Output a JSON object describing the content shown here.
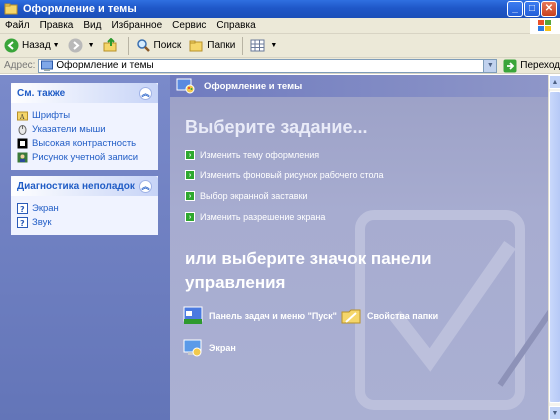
{
  "window": {
    "title": "Оформление и темы",
    "buttons": {
      "minimize": "_",
      "maximize": "□",
      "close": "✕"
    }
  },
  "menu": [
    "Файл",
    "Правка",
    "Вид",
    "Избранное",
    "Сервис",
    "Справка"
  ],
  "toolbar": {
    "back_label": "Назад",
    "search_label": "Поиск",
    "folders_label": "Папки"
  },
  "address": {
    "label": "Адрес:",
    "value": "Оформление и темы",
    "go_label": "Переход"
  },
  "see_also": {
    "title": "См. также",
    "items": [
      "Шрифты",
      "Указатели мыши",
      "Высокая контрастность",
      "Рисунок учетной записи"
    ]
  },
  "troubleshoot": {
    "title": "Диагностика неполадок",
    "items": [
      "Экран",
      "Звук"
    ]
  },
  "main": {
    "header": "Оформление и темы",
    "pick_task": "Выберите задание...",
    "tasks": [
      "Изменить тему оформления",
      "Изменить фоновый рисунок рабочего стола",
      "Выбор экранной заставки",
      "Изменить разрешение экрана"
    ],
    "or_pick": "или выберите значок панели управления",
    "icons": [
      "Панель задач и меню \"Пуск\"",
      "Свойства папки",
      "Экран"
    ]
  },
  "colors": {
    "titlebar": "#1f57c8",
    "link": "#215dc6",
    "task_pane": "#6f7fc1",
    "main_bg": "#a7acd0"
  }
}
